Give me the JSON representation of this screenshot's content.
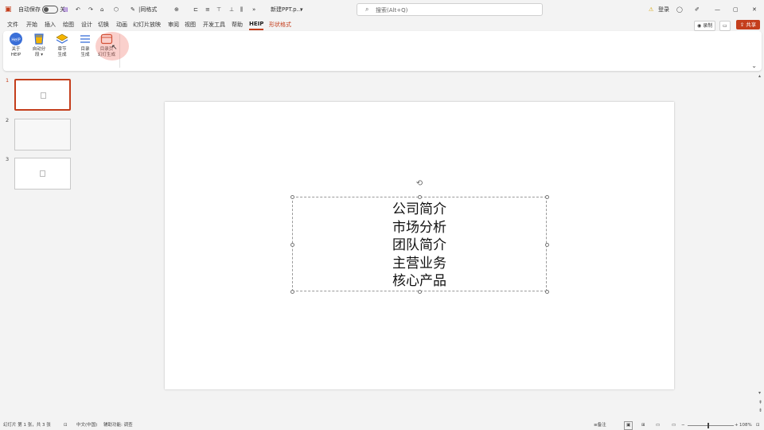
{
  "titlebar": {
    "autosave_label": "自动保存",
    "autosave_state": "关",
    "quick_items": [
      "|同格式"
    ],
    "doc_name": "新建PPT.p...",
    "search_placeholder": "搜索(Alt+Q)",
    "warning_label": "登录"
  },
  "menu": {
    "items": [
      "文件",
      "开始",
      "插入",
      "绘图",
      "设计",
      "切换",
      "动画",
      "幻灯片放映",
      "审阅",
      "视图",
      "开发工具",
      "帮助",
      "HEIP",
      "形状格式"
    ],
    "active": "HEIP",
    "shape_tab": "形状格式"
  },
  "header_buttons": {
    "record_label": "录制",
    "share_label": "共享"
  },
  "ribbon": {
    "groups": [
      {
        "label": "关于\nHEIP",
        "icon": "heip-logo-icon"
      },
      {
        "label": "自动分\n段 ▾",
        "icon": "cup-icon"
      },
      {
        "label": "章节\n生成",
        "icon": "stack-icon"
      },
      {
        "label": "目录\n生成",
        "icon": "list-icon"
      },
      {
        "label": "目录页\n幻灯生成",
        "icon": "window-icon"
      }
    ]
  },
  "slides": {
    "numbers": [
      "1",
      "2",
      "3"
    ],
    "selected": 1
  },
  "slide": {
    "text_lines": [
      "公司简介",
      "市场分析",
      "团队简介",
      "主营业务",
      "核心产品"
    ]
  },
  "status": {
    "slide_info": "幻灯片 第 1 张，共 3 张",
    "language": "中文(中国)",
    "accessibility": "辅助功能: 调查",
    "notes": "备注",
    "zoom": "108%"
  },
  "colors": {
    "accent": "#c43e1c",
    "ribbon_bg": "#ffffff",
    "app_bg": "#f3f3f3"
  }
}
